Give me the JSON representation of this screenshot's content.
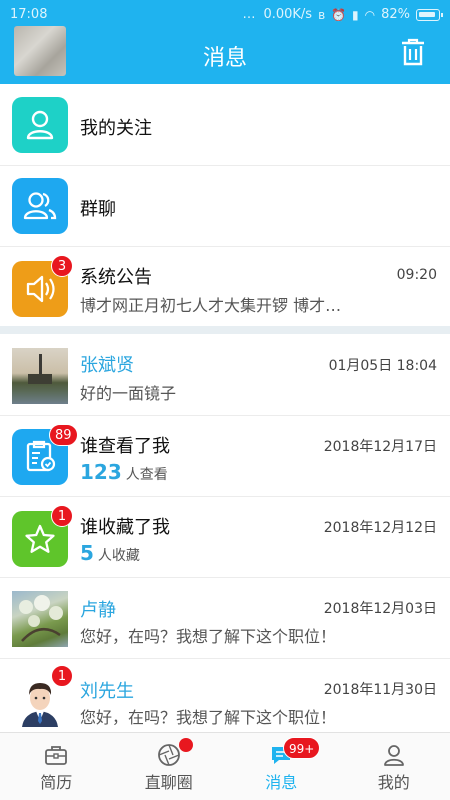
{
  "status_bar": {
    "time": "17:08",
    "speed": "0.00K/s",
    "battery": "82%"
  },
  "header": {
    "title": "消息"
  },
  "rows": [
    {
      "title": "我的关注"
    },
    {
      "title": "群聊"
    },
    {
      "title": "系统公告",
      "time": "09:20",
      "subtitle": "博才网正月初七人才大集开锣 博才…",
      "badge": "3"
    },
    {
      "title": "张斌贤",
      "time": "01月05日 18:04",
      "subtitle": "好的一面镜子"
    },
    {
      "title": "谁查看了我",
      "time": "2018年12月17日",
      "count": "123",
      "count_label": "人查看",
      "badge": "89"
    },
    {
      "title": "谁收藏了我",
      "time": "2018年12月12日",
      "count": "5",
      "count_label": "人收藏",
      "badge": "1"
    },
    {
      "title": "卢静",
      "time": "2018年12月03日",
      "subtitle": "您好，在吗？我想了解下这个职位！"
    },
    {
      "title": "刘先生",
      "time": "2018年11月30日",
      "subtitle": "您好，在吗？我想了解下这个职位！",
      "badge": "1"
    }
  ],
  "nav": {
    "items": [
      {
        "label": "简历",
        "icon": "briefcase-icon"
      },
      {
        "label": "直聊圈",
        "icon": "aperture-icon"
      },
      {
        "label": "消息",
        "icon": "chat-icon",
        "badge": "99+"
      },
      {
        "label": "我的",
        "icon": "person-icon"
      }
    ],
    "active": "消息"
  },
  "colors": {
    "primary": "#1fb3ef",
    "badge": "#e8171f",
    "teal": "#1ed1c7",
    "blue": "#1ea8f0",
    "orange": "#ee9d18",
    "green": "#5fc52b"
  }
}
